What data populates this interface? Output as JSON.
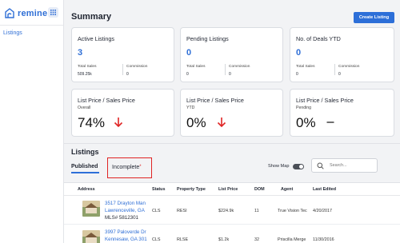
{
  "sidebar": {
    "brand": "remine",
    "items": [
      {
        "label": "Listings"
      }
    ]
  },
  "header": {
    "title": "Summary",
    "create_button": "Create Listing"
  },
  "stats": [
    {
      "title": "Active Listings",
      "value": "3",
      "total_sales_label": "Total Sales",
      "total_sales_value": "509.25k",
      "commission_label": "Commission",
      "commission_value": "0"
    },
    {
      "title": "Pending Listings",
      "value": "0",
      "total_sales_label": "Total Sales",
      "total_sales_value": "0",
      "commission_label": "Commission",
      "commission_value": "0"
    },
    {
      "title": "No. of Deals YTD",
      "value": "0",
      "total_sales_label": "Total Sales",
      "total_sales_value": "0",
      "commission_label": "Commission",
      "commission_value": "0"
    }
  ],
  "kpis": [
    {
      "title": "List Price / Sales Price",
      "subtitle": "Overall",
      "value": "74%",
      "trend": "down"
    },
    {
      "title": "List Price / Sales Price",
      "subtitle": "YTD",
      "value": "0%",
      "trend": "down"
    },
    {
      "title": "List Price / Sales Price",
      "subtitle": "Pending",
      "value": "0%",
      "trend": "flat"
    }
  ],
  "listings": {
    "title": "Listings",
    "tabs": [
      {
        "label": "Published",
        "active": true
      },
      {
        "label": "Incomplete",
        "marker": "*"
      }
    ],
    "show_map_label": "Show Map",
    "search_placeholder": "Search...",
    "columns": [
      "Address",
      "Status",
      "Property Type",
      "List Price",
      "DOM",
      "Agent",
      "Last Edited"
    ],
    "rows": [
      {
        "address_line1": "3517 Drayton Man",
        "address_line2": "Lawrenceville, GA",
        "mls": "MLS# 5812301",
        "status": "CLS",
        "property_type": "RESI",
        "list_price": "$224.9k",
        "dom": "11",
        "agent": "True Vision Tec",
        "last_edited": "4/20/2017"
      },
      {
        "address_line1": "3997 Paloverde Dr",
        "address_line2": "Kennesaw, GA 301",
        "mls": "",
        "status": "CLS",
        "property_type": "RLSE",
        "list_price": "$1.2k",
        "dom": "32",
        "agent": "Priscilla Merge",
        "last_edited": "11/30/2016"
      }
    ]
  },
  "colors": {
    "accent": "#2d6fd8",
    "highlight_box": "#e02424",
    "down_arrow": "#e02424"
  }
}
